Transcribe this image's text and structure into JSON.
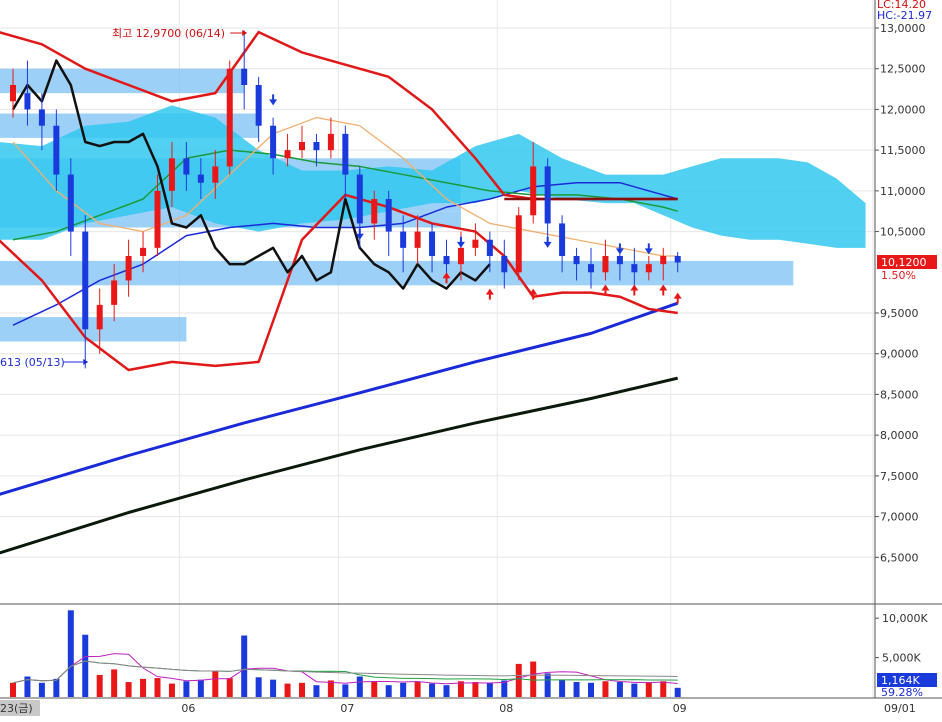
{
  "chart_data": {
    "type": "candlestick",
    "price_axis": {
      "min": 6.0,
      "max": 13.0,
      "ticks": [
        "13,0000",
        "12,5000",
        "12,0000",
        "11,5000",
        "11,0000",
        "10,5000",
        "9,5000",
        "9,0000",
        "8,5000",
        "8,0000",
        "7,5000",
        "7,0000",
        "6,5000"
      ],
      "tick_values": [
        13.0,
        12.5,
        12.0,
        11.5,
        11.0,
        10.5,
        9.5,
        9.0,
        8.5,
        8.0,
        7.5,
        7.0,
        6.5
      ]
    },
    "volume_axis": {
      "ticks": [
        "10,000K",
        "5,000K"
      ],
      "tick_values": [
        10000,
        5000
      ],
      "max": 11800
    },
    "x_axis": {
      "labels": [
        {
          "text": "23(금)",
          "day": 0,
          "highlight": true
        },
        {
          "text": "06",
          "day": 12
        },
        {
          "text": "07",
          "day": 23
        },
        {
          "text": "08",
          "day": 34
        },
        {
          "text": "09",
          "day": 46
        },
        {
          "text": "09/01",
          "day": 60
        }
      ],
      "days_visible": 62
    },
    "header_labels": {
      "lc": "LC:14.20",
      "hc": "HC:-21.97"
    },
    "current_price": {
      "label": "10,1200",
      "pct": "1.50%",
      "value": 10.12
    },
    "current_volume": {
      "label": "1,164K",
      "pct": "59.28%",
      "value": 1164
    },
    "annotations": {
      "high": {
        "label": "최고 12,9700 (06/14)",
        "value": 12.97,
        "day": 16
      },
      "low": {
        "label": "613 (05/13)",
        "value": 8.82,
        "day": 5
      }
    },
    "candles": [
      [
        12.1,
        12.3,
        12.5,
        11.9
      ],
      [
        12.2,
        12.0,
        12.6,
        11.8
      ],
      [
        12.0,
        11.8,
        12.2,
        11.5
      ],
      [
        11.8,
        11.2,
        12.0,
        11.0
      ],
      [
        11.2,
        10.5,
        11.4,
        10.2
      ],
      [
        10.5,
        9.3,
        10.7,
        8.82
      ],
      [
        9.3,
        9.6,
        9.8,
        9.0
      ],
      [
        9.6,
        9.9,
        10.1,
        9.4
      ],
      [
        9.9,
        10.2,
        10.4,
        9.7
      ],
      [
        10.2,
        10.3,
        10.5,
        10.0
      ],
      [
        10.3,
        11.0,
        11.2,
        10.2
      ],
      [
        11.0,
        11.4,
        11.6,
        10.8
      ],
      [
        11.4,
        11.2,
        11.6,
        11.0
      ],
      [
        11.2,
        11.1,
        11.4,
        10.9
      ],
      [
        11.1,
        11.3,
        11.5,
        10.9
      ],
      [
        11.3,
        12.5,
        12.6,
        11.2
      ],
      [
        12.5,
        12.3,
        12.97,
        12.0
      ],
      [
        12.3,
        11.8,
        12.4,
        11.6
      ],
      [
        11.8,
        11.4,
        11.9,
        11.2
      ],
      [
        11.4,
        11.5,
        11.7,
        11.3
      ],
      [
        11.5,
        11.6,
        11.8,
        11.4
      ],
      [
        11.6,
        11.5,
        11.7,
        11.3
      ],
      [
        11.5,
        11.7,
        11.9,
        11.4
      ],
      [
        11.7,
        11.2,
        11.8,
        10.9
      ],
      [
        11.2,
        10.6,
        11.3,
        10.3
      ],
      [
        10.6,
        10.9,
        11.0,
        10.4
      ],
      [
        10.9,
        10.5,
        11.0,
        10.2
      ],
      [
        10.5,
        10.3,
        10.7,
        10.0
      ],
      [
        10.3,
        10.5,
        10.7,
        10.1
      ],
      [
        10.5,
        10.2,
        10.6,
        10.0
      ],
      [
        10.2,
        10.1,
        10.4,
        9.9
      ],
      [
        10.1,
        10.3,
        10.5,
        9.9
      ],
      [
        10.3,
        10.4,
        10.6,
        10.2
      ],
      [
        10.4,
        10.2,
        10.5,
        10.0
      ],
      [
        10.2,
        10.0,
        10.4,
        9.8
      ],
      [
        10.0,
        10.7,
        10.8,
        9.9
      ],
      [
        10.7,
        11.3,
        11.6,
        10.6
      ],
      [
        11.3,
        10.6,
        11.4,
        10.4
      ],
      [
        10.6,
        10.2,
        10.7,
        10.0
      ],
      [
        10.2,
        10.1,
        10.3,
        9.9
      ],
      [
        10.1,
        10.0,
        10.3,
        9.8
      ],
      [
        10.0,
        10.2,
        10.4,
        9.9
      ],
      [
        10.2,
        10.1,
        10.3,
        9.9
      ],
      [
        10.1,
        10.0,
        10.3,
        9.8
      ],
      [
        10.0,
        10.1,
        10.2,
        9.9
      ],
      [
        10.1,
        10.2,
        10.3,
        9.9
      ],
      [
        10.2,
        10.12,
        10.25,
        10.0
      ]
    ],
    "volume": [
      1800,
      2600,
      1800,
      2300,
      11000,
      7900,
      2800,
      3500,
      1900,
      2300,
      2400,
      1700,
      2000,
      2200,
      3300,
      2400,
      7800,
      2500,
      2200,
      1700,
      1800,
      1500,
      2100,
      1600,
      2600,
      2000,
      1500,
      1800,
      1900,
      1700,
      1500,
      2000,
      1900,
      1800,
      2100,
      4200,
      4500,
      3000,
      2200,
      1900,
      1800,
      2000,
      1900,
      1700,
      1800,
      2000,
      1164
    ],
    "series": [
      {
        "name": "ma-blue",
        "color": "#1a2ad8",
        "x": [
          0,
          3,
          6,
          9,
          12,
          15,
          18,
          21,
          24,
          27,
          30,
          33,
          36,
          39,
          42,
          45,
          46
        ],
        "values": [
          9.35,
          9.6,
          9.9,
          10.1,
          10.45,
          10.55,
          10.6,
          10.55,
          10.55,
          10.6,
          10.8,
          10.9,
          11.05,
          11.1,
          11.1,
          10.95,
          10.9
        ]
      },
      {
        "name": "ma-green",
        "color": "#1a9a3a",
        "x": [
          0,
          3,
          6,
          9,
          12,
          15,
          18,
          21,
          24,
          27,
          30,
          33,
          36,
          39,
          42,
          45,
          46
        ],
        "values": [
          10.4,
          10.5,
          10.7,
          10.9,
          11.4,
          11.5,
          11.45,
          11.35,
          11.3,
          11.2,
          11.1,
          11.0,
          10.95,
          10.95,
          10.9,
          10.8,
          10.75
        ]
      },
      {
        "name": "ma-orange",
        "color": "#f0b070",
        "x": [
          0,
          3,
          6,
          9,
          12,
          15,
          18,
          21,
          24,
          27,
          30,
          33,
          36,
          39,
          42,
          45,
          46
        ],
        "values": [
          11.6,
          11.0,
          10.6,
          10.5,
          10.7,
          11.2,
          11.7,
          11.9,
          11.8,
          11.4,
          10.9,
          10.6,
          10.5,
          10.4,
          10.3,
          10.2,
          10.2
        ]
      },
      {
        "name": "long-blue",
        "color": "#1a2ad8",
        "x": [
          -1,
          8,
          16,
          24,
          32,
          40,
          46
        ],
        "values": [
          7.27,
          7.75,
          8.15,
          8.52,
          8.9,
          9.25,
          9.62
        ]
      },
      {
        "name": "long-dark",
        "color": "#0a1a0a",
        "x": [
          -1,
          8,
          16,
          24,
          32,
          40,
          46
        ],
        "values": [
          6.55,
          7.05,
          7.45,
          7.82,
          8.15,
          8.45,
          8.7
        ]
      },
      {
        "name": "band-upper",
        "color": "#e01818",
        "x": [
          -1,
          2,
          5,
          8,
          11,
          14,
          17,
          20,
          23,
          26,
          29,
          32,
          34,
          36,
          38,
          40,
          42,
          44,
          46
        ],
        "values": [
          12.95,
          12.8,
          12.5,
          12.3,
          12.1,
          12.2,
          12.95,
          12.7,
          12.55,
          12.4,
          12.0,
          11.4,
          10.95,
          10.9,
          10.9,
          10.9,
          10.9,
          10.9,
          10.9
        ]
      },
      {
        "name": "band-lower",
        "color": "#e01818",
        "x": [
          -1,
          2,
          5,
          8,
          11,
          14,
          17,
          20,
          23,
          26,
          29,
          32,
          34,
          36,
          38,
          40,
          42,
          44,
          46
        ],
        "values": [
          10.4,
          9.9,
          9.2,
          8.8,
          8.9,
          8.85,
          8.9,
          10.4,
          10.95,
          10.8,
          10.6,
          10.5,
          10.2,
          9.7,
          9.75,
          9.75,
          9.7,
          9.55,
          9.5
        ]
      },
      {
        "name": "osc-black",
        "color": "#111111",
        "x": [
          0,
          1,
          2,
          3,
          4,
          5,
          6,
          7,
          8,
          9,
          10,
          11,
          12,
          13,
          14,
          15,
          16,
          17,
          18,
          19,
          20,
          21,
          22,
          23,
          24,
          25,
          26,
          27,
          28,
          29,
          30,
          31,
          32,
          33
        ],
        "values": [
          12.0,
          12.3,
          12.1,
          12.6,
          12.3,
          11.6,
          11.55,
          11.6,
          11.6,
          11.7,
          11.3,
          10.6,
          10.55,
          10.7,
          10.3,
          10.1,
          10.1,
          10.2,
          10.3,
          10.0,
          10.2,
          9.9,
          10.0,
          10.9,
          10.3,
          10.1,
          10.0,
          9.8,
          10.1,
          9.9,
          9.8,
          10.0,
          9.9,
          10.1
        ]
      },
      {
        "name": "dark-red",
        "color": "#8a1010",
        "x": [
          34,
          36,
          38,
          40,
          42,
          44,
          46
        ],
        "values": [
          10.9,
          10.9,
          10.9,
          10.9,
          10.9,
          10.9,
          10.9
        ]
      }
    ],
    "cloud": {
      "color": "#33c8f0",
      "x": [
        -1,
        2,
        5,
        8,
        11,
        14,
        17,
        20,
        23,
        26,
        29,
        32,
        35,
        38,
        41,
        43,
        45,
        47,
        49,
        51,
        53,
        55,
        57,
        59
      ],
      "upper": [
        11.6,
        11.55,
        11.8,
        11.85,
        12.05,
        11.9,
        11.5,
        11.25,
        11.25,
        11.3,
        11.25,
        11.55,
        11.7,
        11.4,
        11.2,
        11.2,
        11.2,
        11.3,
        11.4,
        11.4,
        11.4,
        11.35,
        11.15,
        10.85
      ],
      "lower": [
        10.4,
        10.4,
        10.6,
        10.7,
        10.8,
        10.6,
        10.5,
        10.6,
        10.65,
        10.75,
        10.85,
        10.85,
        11.0,
        10.9,
        10.85,
        10.85,
        10.7,
        10.55,
        10.45,
        10.4,
        10.4,
        10.35,
        10.3,
        10.3
      ]
    },
    "zones": [
      {
        "from_day": -1,
        "to_day": 16,
        "from": 12.2,
        "to": 12.5
      },
      {
        "from_day": -1,
        "to_day": 17,
        "from": 11.65,
        "to": 11.95
      },
      {
        "from_day": -1,
        "to_day": 31,
        "from": 10.75,
        "to": 11.4
      },
      {
        "from_day": -1,
        "to_day": 31,
        "from": 10.55,
        "to": 10.75
      },
      {
        "from_day": -1,
        "to_day": 54,
        "from": 9.84,
        "to": 10.14
      },
      {
        "from_day": -1,
        "to_day": 12,
        "from": 9.15,
        "to": 9.45
      }
    ],
    "markers": [
      {
        "day": 18,
        "dir": "down",
        "value": 12.05
      },
      {
        "day": 24,
        "dir": "down",
        "value": 10.4
      },
      {
        "day": 31,
        "dir": "down",
        "value": 10.3
      },
      {
        "day": 37,
        "dir": "down",
        "value": 10.3
      },
      {
        "day": 42,
        "dir": "down",
        "value": 10.22
      },
      {
        "day": 44,
        "dir": "down",
        "value": 10.22
      },
      {
        "day": 30,
        "dir": "up",
        "value": 10.0
      },
      {
        "day": 33,
        "dir": "up",
        "value": 9.8
      },
      {
        "day": 36,
        "dir": "up",
        "value": 9.8
      },
      {
        "day": 41,
        "dir": "up",
        "value": 9.85
      },
      {
        "day": 43,
        "dir": "up",
        "value": 9.85
      },
      {
        "day": 45,
        "dir": "up",
        "value": 9.85
      },
      {
        "day": 46,
        "dir": "up",
        "value": 9.75
      }
    ]
  }
}
